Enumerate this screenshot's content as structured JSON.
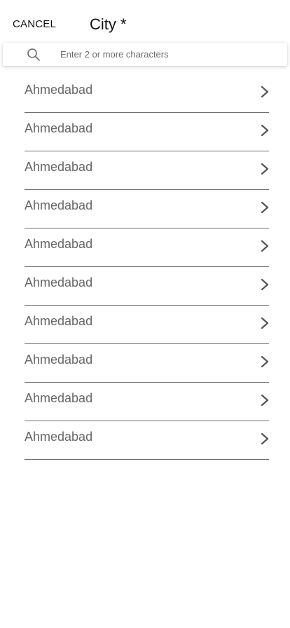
{
  "header": {
    "cancel_label": "CANCEL",
    "title": "City *"
  },
  "search": {
    "placeholder": "Enter 2 or more characters",
    "value": ""
  },
  "cities": [
    {
      "label": "Ahmedabad"
    },
    {
      "label": "Ahmedabad"
    },
    {
      "label": "Ahmedabad"
    },
    {
      "label": "Ahmedabad"
    },
    {
      "label": "Ahmedabad"
    },
    {
      "label": "Ahmedabad"
    },
    {
      "label": "Ahmedabad"
    },
    {
      "label": "Ahmedabad"
    },
    {
      "label": "Ahmedabad"
    },
    {
      "label": "Ahmedabad"
    }
  ],
  "icons": {
    "search": "search-icon",
    "row_arrow": "chevron-right-icon"
  },
  "colors": {
    "text_primary": "#111111",
    "row_text": "#666666",
    "divider": "#6f6f6f",
    "background": "#ffffff"
  }
}
